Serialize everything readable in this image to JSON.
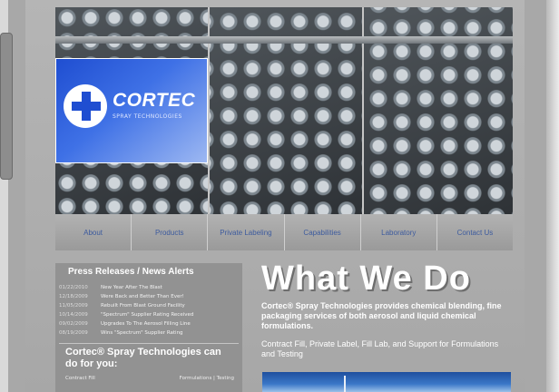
{
  "logo": {
    "name": "CORTEC",
    "tagline": "SPRAY TECHNOLOGIES"
  },
  "nav": {
    "items": [
      {
        "label": "About"
      },
      {
        "label": "Products"
      },
      {
        "label": "Private Labeling"
      },
      {
        "label": "Capabilities"
      },
      {
        "label": "Laboratory"
      },
      {
        "label": "Contact Us"
      }
    ]
  },
  "news": {
    "title": "Press Releases / News Alerts",
    "rows": [
      {
        "date": "01/22/2010",
        "text": "New Year After The Blast"
      },
      {
        "date": "12/18/2009",
        "text": "Were Back and Better Than Ever!"
      },
      {
        "date": "11/05/2009",
        "text": "Rebuilt From Blast Ground Facility"
      },
      {
        "date": "10/14/2009",
        "text": "\"Spectrum\" Supplier Rating Received"
      },
      {
        "date": "09/02/2009",
        "text": "Upgrades To The Aerosol Filling Line"
      },
      {
        "date": "08/19/2009",
        "text": "Wins \"Spectrum\" Supplier Rating"
      }
    ],
    "promo": "Cortec® Spray Technologies can do for you:",
    "promo_left": "Contract Fill",
    "promo_right": "Formulations | Testing"
  },
  "main": {
    "headline": "What We Do",
    "intro": "Cortec® Spray Technologies provides chemical blending, fine packaging services of both aerosol and liquid chemical formulations.",
    "services": "Contract Fill, Private Label, Fill Lab, and Support for Formulations and Testing"
  },
  "colors": {
    "page_background": "#a8a8a8",
    "logo_blue": "#1f4ed1",
    "nav_text": "#3d5b9e",
    "headline_text": "#ffffff"
  }
}
